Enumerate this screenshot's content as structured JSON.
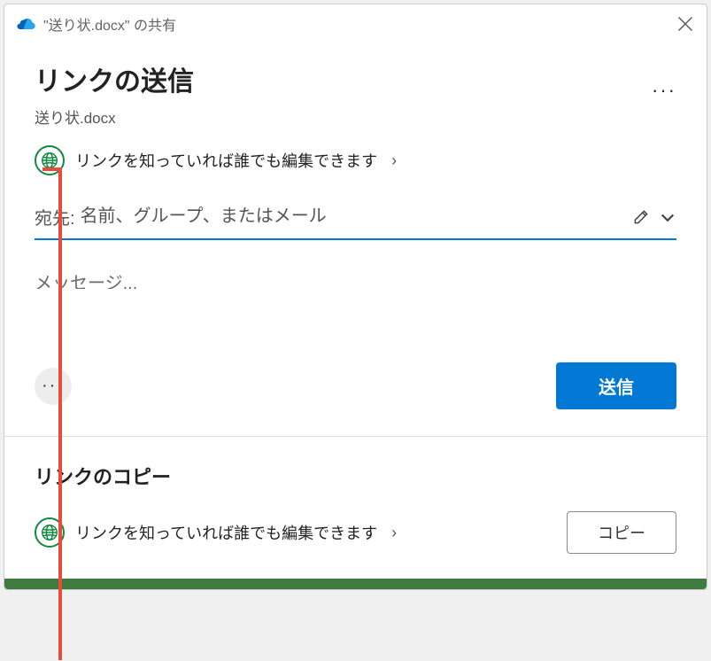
{
  "titlebar": {
    "text": "\"送り状.docx\" の共有"
  },
  "header": {
    "title": "リンクの送信",
    "filename": "送り状.docx"
  },
  "permission": {
    "text": "リンクを知っていれば誰でも編集できます"
  },
  "recipient": {
    "label": "宛先:",
    "placeholder": "名前、グループ、またはメール"
  },
  "message": {
    "placeholder": "メッセージ..."
  },
  "actions": {
    "send": "送信"
  },
  "copySection": {
    "title": "リンクのコピー",
    "permText": "リンクを知っていれば誰でも編集できます",
    "copyButton": "コピー"
  }
}
